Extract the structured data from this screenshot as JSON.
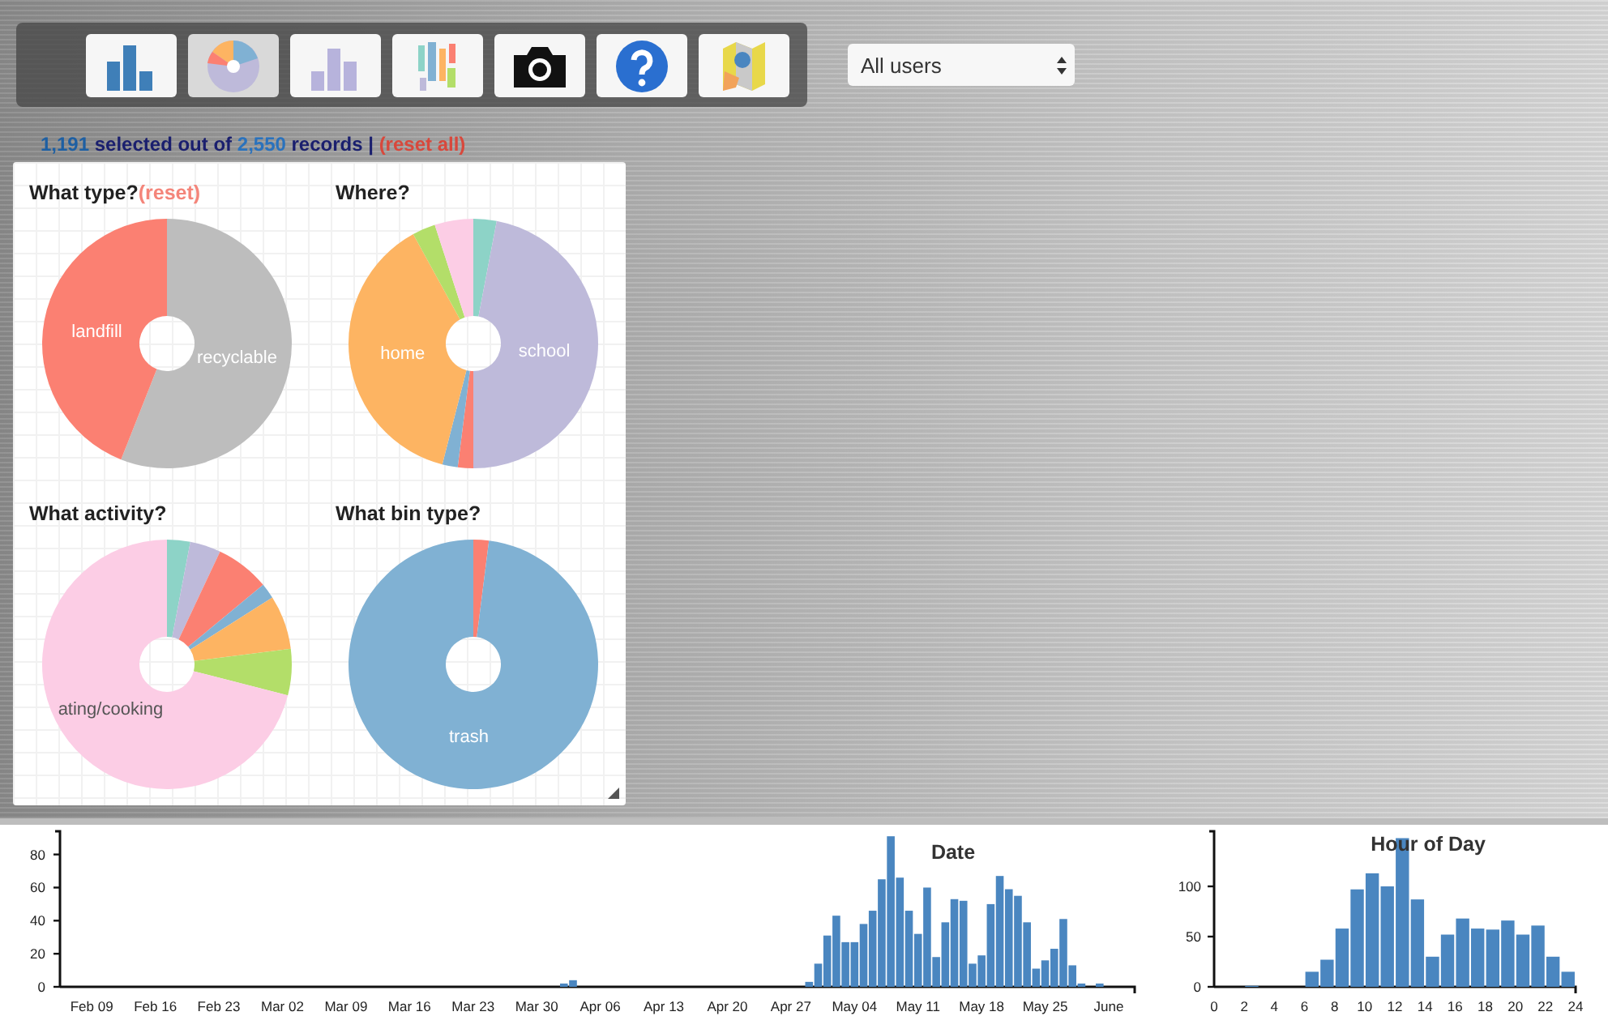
{
  "toolbar": {
    "buttons": [
      {
        "kind": "bar",
        "selected": false
      },
      {
        "kind": "pie",
        "selected": true
      },
      {
        "kind": "bar-light",
        "selected": false
      },
      {
        "kind": "wordcloud",
        "selected": false
      },
      {
        "kind": "camera",
        "selected": false
      },
      {
        "kind": "help",
        "selected": false
      },
      {
        "kind": "map",
        "selected": false
      }
    ]
  },
  "user_select": {
    "value": "All users"
  },
  "status": {
    "selected_count": "1,191",
    "text_1": "selected out of",
    "total_count": "2,550",
    "text_2": "records |",
    "reset_link": "(reset all)"
  },
  "pies": [
    {
      "title": "What type?",
      "reset_link": "(reset)",
      "chart_data": {
        "type": "donut",
        "categories": [
          "recyclable",
          "landfill"
        ],
        "series": [
          {
            "values": [
              56,
              44
            ]
          }
        ],
        "colors": [
          "#bdbdbd",
          "#fb8072"
        ]
      }
    },
    {
      "title": "Where?",
      "chart_data": {
        "type": "donut",
        "categories": [
          null,
          "school",
          null,
          null,
          "home",
          null,
          null
        ],
        "series": [
          {
            "values": [
              3,
              47,
              2,
              2,
              38,
              3,
              5
            ]
          }
        ],
        "colors": [
          "#8dd3c7",
          "#bebada",
          "#fb8072",
          "#80b1d3",
          "#fdb462",
          "#b3de69",
          "#fccde5"
        ]
      }
    },
    {
      "title": "What activity?",
      "chart_data": {
        "type": "donut",
        "categories": [
          null,
          null,
          null,
          null,
          null,
          null,
          "ating/cooking"
        ],
        "series": [
          {
            "values": [
              3,
              4,
              7,
              2,
              7,
              6,
              71
            ]
          }
        ],
        "colors": [
          "#8dd3c7",
          "#bebada",
          "#fb8072",
          "#80b1d3",
          "#fdb462",
          "#b3de69",
          "#fccde5"
        ]
      }
    },
    {
      "title": "What bin type?",
      "chart_data": {
        "type": "donut",
        "categories": [
          null,
          "trash"
        ],
        "series": [
          {
            "values": [
              2,
              98
            ]
          }
        ],
        "colors": [
          "#fb8072",
          "#80b1d3"
        ]
      }
    }
  ],
  "date_chart": {
    "chart_data": {
      "type": "bar",
      "title": "Date",
      "categories": [
        null,
        null,
        null,
        "Feb 09",
        null,
        null,
        null,
        null,
        null,
        null,
        "Feb 16",
        null,
        null,
        null,
        null,
        null,
        null,
        "Feb 23",
        null,
        null,
        null,
        null,
        null,
        null,
        "Mar 02",
        null,
        null,
        null,
        null,
        null,
        null,
        "Mar 09",
        null,
        null,
        null,
        null,
        null,
        null,
        "Mar 16",
        null,
        null,
        null,
        null,
        null,
        null,
        "Mar 23",
        null,
        null,
        null,
        null,
        null,
        null,
        "Mar 30",
        null,
        null,
        null,
        null,
        null,
        null,
        "Apr 06",
        null,
        null,
        null,
        null,
        null,
        null,
        "Apr 13",
        null,
        null,
        null,
        null,
        null,
        null,
        "Apr 20",
        null,
        null,
        null,
        null,
        null,
        null,
        "Apr 27",
        null,
        null,
        null,
        null,
        null,
        null,
        "May 04",
        null,
        null,
        null,
        null,
        null,
        null,
        "May 11",
        null,
        null,
        null,
        null,
        null,
        null,
        "May 18",
        null,
        null,
        null,
        null,
        null,
        null,
        "May 25",
        null,
        null,
        null,
        null,
        null,
        null,
        "June",
        null,
        null
      ],
      "series": [
        {
          "color": "#4a86c0",
          "values": [
            null,
            null,
            null,
            null,
            null,
            null,
            null,
            null,
            null,
            null,
            null,
            null,
            null,
            null,
            null,
            null,
            null,
            null,
            null,
            null,
            null,
            null,
            null,
            null,
            null,
            null,
            null,
            null,
            null,
            null,
            null,
            null,
            null,
            null,
            null,
            null,
            null,
            null,
            null,
            null,
            null,
            null,
            null,
            null,
            null,
            null,
            null,
            null,
            null,
            null,
            null,
            null,
            null,
            null,
            null,
            2,
            4,
            null,
            null,
            null,
            null,
            null,
            null,
            null,
            null,
            null,
            null,
            null,
            null,
            null,
            null,
            null,
            null,
            null,
            null,
            null,
            null,
            null,
            null,
            null,
            null,
            null,
            3,
            14,
            31,
            43,
            27,
            27,
            38,
            46,
            65,
            91,
            66,
            46,
            32,
            60,
            18,
            39,
            53,
            52,
            14,
            19,
            50,
            67,
            59,
            55,
            39,
            11,
            16,
            23,
            41,
            13,
            2,
            null,
            2,
            null,
            null,
            null
          ]
        }
      ],
      "ylim": [
        0,
        95
      ],
      "yticks": [
        0,
        20,
        40,
        60,
        80
      ]
    }
  },
  "hour_chart": {
    "chart_data": {
      "type": "bar",
      "title": "Hour of Day",
      "x": [
        2.5,
        6.5,
        7.5,
        8.5,
        9.5,
        10.5,
        11.5,
        12.5,
        13.5,
        14.5,
        15.5,
        16.5,
        17.5,
        18.5,
        19.5,
        20.5,
        21.5,
        22.5,
        23.5
      ],
      "series": [
        {
          "color": "#4a86c0",
          "values": [
            1,
            15,
            27,
            58,
            97,
            113,
            100,
            148,
            87,
            30,
            52,
            68,
            58,
            57,
            66,
            52,
            61,
            30,
            15
          ]
        }
      ],
      "xlim": [
        0,
        24
      ],
      "ylim": [
        0,
        150
      ],
      "yticks": [
        0,
        50,
        100
      ],
      "xticks": [
        0,
        2,
        4,
        6,
        8,
        10,
        12,
        14,
        16,
        18,
        20,
        22,
        24
      ]
    }
  }
}
